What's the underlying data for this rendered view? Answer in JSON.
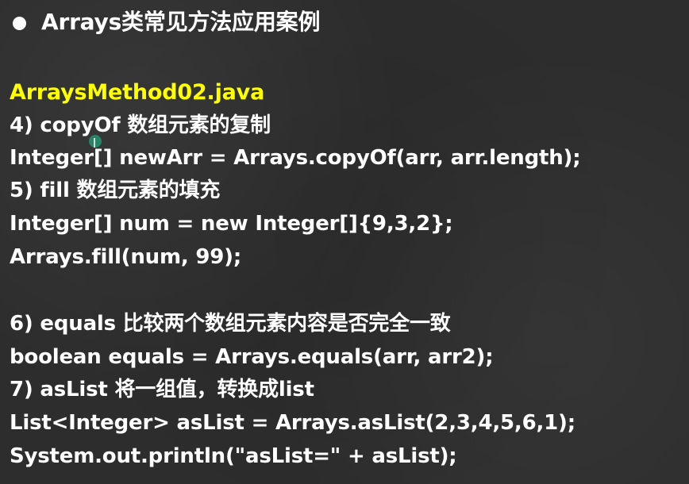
{
  "slide": {
    "title": "Arrays类常见方法应用案例",
    "filename": "ArraysMethod02.java",
    "lines": [
      "4) copyOf 数组元素的复制",
      "Integer[] newArr = Arrays.copyOf(arr, arr.length);",
      "5) fill 数组元素的填充",
      "Integer[] num = new Integer[]{9,3,2};",
      "Arrays.fill(num, 99);",
      "6) equals 比较两个数组元素内容是否完全一致",
      "boolean equals = Arrays.equals(arr, arr2);",
      "7) asList 将一组值，转换成list",
      "List<Integer> asList = Arrays.asList(2,3,4,5,6,1);",
      "System.out.println(\"asList=\" + asList);"
    ]
  },
  "colors": {
    "background": "#2d2d2d",
    "text": "#ffffff",
    "filename": "#ffff00",
    "cursor": "#22a078"
  }
}
